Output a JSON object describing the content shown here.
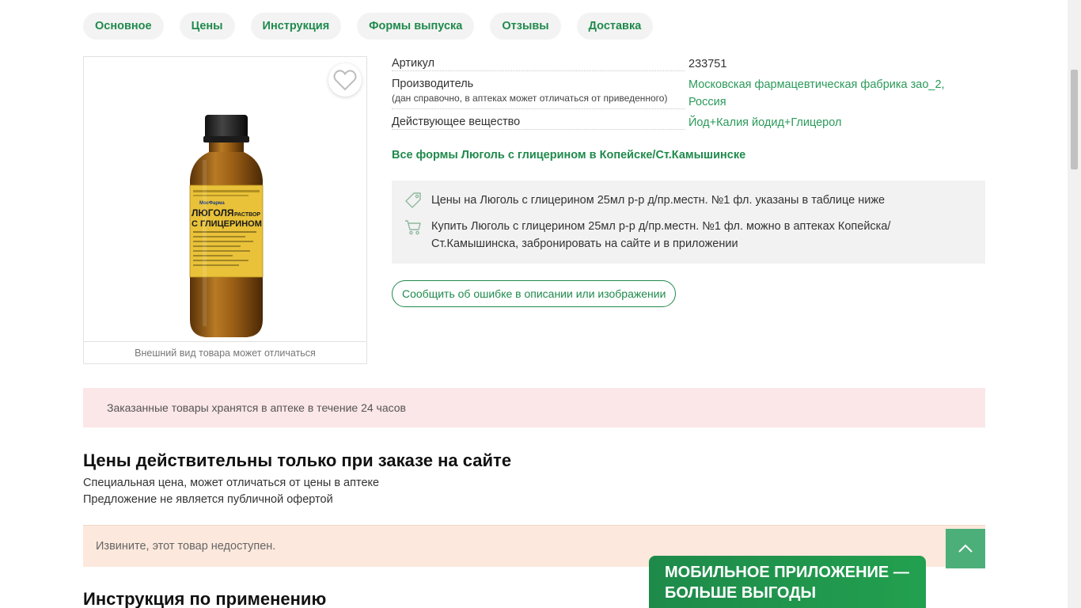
{
  "tabs": [
    {
      "label": "Основное"
    },
    {
      "label": "Цены"
    },
    {
      "label": "Инструкция"
    },
    {
      "label": "Формы выпуска"
    },
    {
      "label": "Отзывы"
    },
    {
      "label": "Доставка"
    }
  ],
  "product_image": {
    "caption": "Внешний вид товара может отличаться",
    "label_brand": "МосФарма",
    "label_line1": "ЛЮГОЛЯ",
    "label_line1b": "РАСТВОР",
    "label_line2": "С ГЛИЦЕРИНОМ"
  },
  "attributes": [
    {
      "label": "Артикул",
      "note": "",
      "value": "233751"
    },
    {
      "label": "Производитель",
      "note": "(дан справочно, в аптеках может отличаться от приведенного)",
      "value_line1": "Московская фармацевтическая фабрика зао_2,",
      "value_line2": "Россия"
    },
    {
      "label": "Действующее вещество",
      "note": "",
      "value": "Йод+Калия йодид+Глицерол"
    }
  ],
  "all_forms_link": "Все формы Люголь с глицерином в Копейске/Ст.Камышинске",
  "info_box": {
    "prices_text": "Цены на Люголь с глицерином 25мл р-р д/пр.местн. №1 фл. указаны в таблице ниже",
    "buy_text_line1": "Купить Люголь с глицерином 25мл р-р д/пр.местн. №1 фл. можно в аптеках Копейска/",
    "buy_text_line2": "Ст.Камышинска, забронировать на сайте и в приложении"
  },
  "report_button": "Сообщить об ошибке в описании или изображении",
  "notice": "Заказанные товары хранятся в аптеке в течение 24 часов",
  "prices_section": {
    "title": "Цены действительны только при заказе на сайте",
    "sub1": "Специальная цена, может отличаться от цены в аптеке",
    "sub2": "Предложение не является публичной офертой"
  },
  "unavailable": "Извините, этот товар недоступен.",
  "instruction_title": "Инструкция по применению",
  "app_banner": {
    "line1": "МОБИЛЬНОЕ ПРИЛОЖЕНИЕ —",
    "line2": "БОЛЬШЕ ВЫГОДЫ"
  },
  "colors": {
    "brand_green": "#1f8a4c",
    "link_green": "#2a9a5a",
    "notice_pink": "#fbe6e8",
    "unavailable_peach": "#fce8dc"
  },
  "icons": [
    "heart-icon",
    "price-tag-icon",
    "cart-icon",
    "chevron-up-icon"
  ]
}
